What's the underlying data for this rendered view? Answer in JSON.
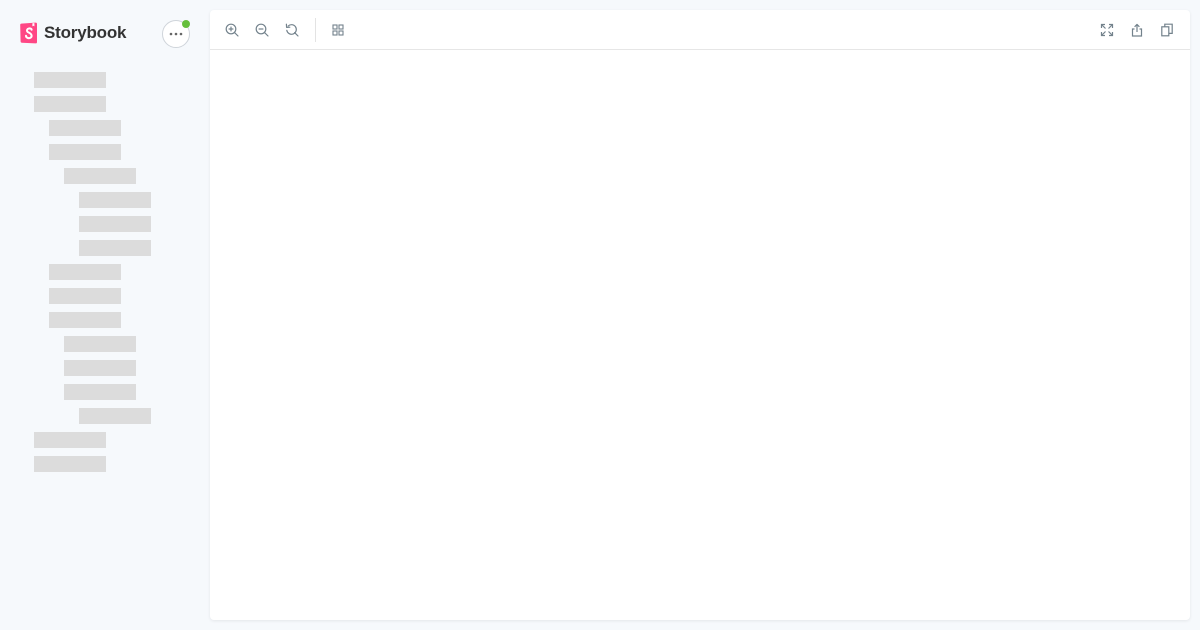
{
  "brand": {
    "name": "Storybook",
    "color": "#ff4785"
  },
  "sidebar": {
    "menu_icon": "ellipsis-icon",
    "status_color": "#66bf3c",
    "skeleton_count": 17
  },
  "toolbar": {
    "left_tools": [
      "zoom-in-icon",
      "zoom-out-icon",
      "zoom-reset-icon",
      "grid-icon"
    ],
    "right_tools": [
      "fullscreen-icon",
      "share-icon",
      "copy-icon"
    ]
  }
}
